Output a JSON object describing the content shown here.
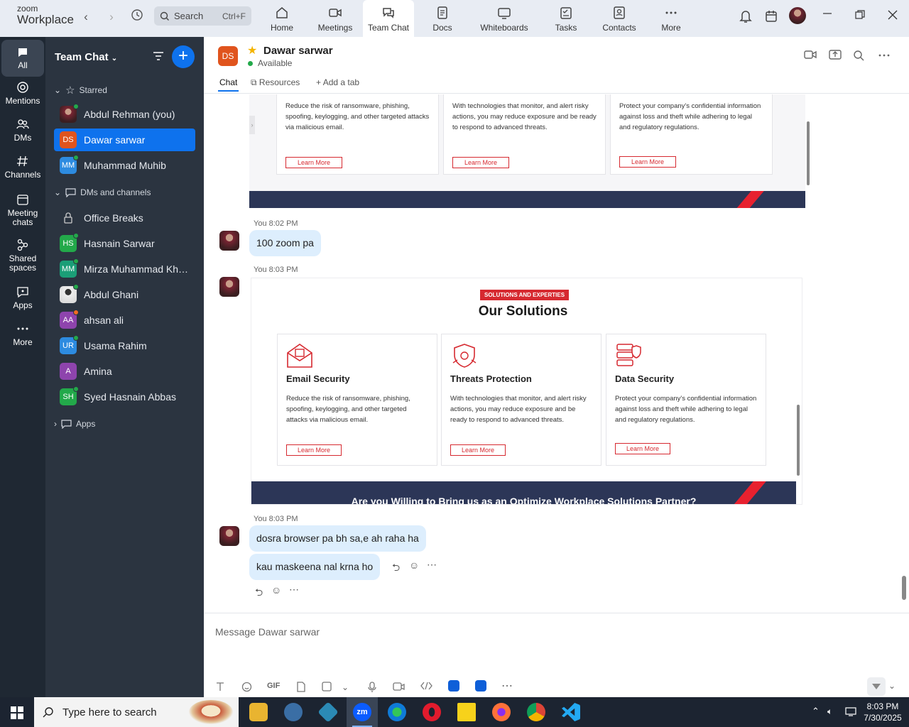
{
  "app": {
    "logo_top": "zoom",
    "logo_bottom": "Workplace"
  },
  "top": {
    "search_label": "Search",
    "search_shortcut": "Ctrl+F",
    "tabs": [
      {
        "label": "Home"
      },
      {
        "label": "Meetings"
      },
      {
        "label": "Team Chat"
      },
      {
        "label": "Docs"
      },
      {
        "label": "Whiteboards"
      },
      {
        "label": "Tasks"
      },
      {
        "label": "Contacts"
      },
      {
        "label": "More"
      }
    ]
  },
  "rail": [
    {
      "label": "All"
    },
    {
      "label": "Mentions"
    },
    {
      "label": "DMs"
    },
    {
      "label": "Channels"
    },
    {
      "label": "Meeting chats"
    },
    {
      "label": "Shared spaces"
    },
    {
      "label": "Apps"
    },
    {
      "label": "More"
    }
  ],
  "sidebar": {
    "title": "Team Chat",
    "starred_label": "Starred",
    "starred": [
      {
        "name": "Abdul Rehman (you)"
      },
      {
        "initials": "DS",
        "name": "Dawar sarwar",
        "color": "#e0541d"
      },
      {
        "initials": "MM",
        "name": "Muhammad Muhib",
        "color": "#2d8be0"
      }
    ],
    "dms_label": "DMs and channels",
    "dms": [
      {
        "name": "Office Breaks"
      },
      {
        "initials": "HS",
        "name": "Hasnain Sarwar",
        "color": "#23a94a"
      },
      {
        "initials": "MM",
        "name": "Mirza Muhammad Khur...",
        "color": "#1b9e77"
      },
      {
        "name": "Abdul Ghani"
      },
      {
        "initials": "AA",
        "name": "ahsan ali",
        "color": "#8e44ad"
      },
      {
        "initials": "UR",
        "name": "Usama Rahim",
        "color": "#2d8be0"
      },
      {
        "initials": "A",
        "name": "Amina",
        "color": "#8e44ad"
      },
      {
        "initials": "SH",
        "name": "Syed Hasnain Abbas",
        "color": "#23a94a"
      }
    ],
    "apps_label": "Apps"
  },
  "chat": {
    "initials": "DS",
    "name": "Dawar sarwar",
    "status": "Available",
    "tabs": {
      "chat": "Chat",
      "resources": "Resources",
      "add": "Add a tab"
    }
  },
  "image1": {
    "cards": [
      {
        "desc": "Reduce the risk of ransomware, phishing, spoofing, keylogging, and other targeted attacks via malicious email.",
        "btn": "Learn More"
      },
      {
        "desc": "With technologies that monitor, and alert risky actions, you may reduce exposure and be ready to respond to advanced threats.",
        "btn": "Learn More"
      },
      {
        "desc": "Protect your company's confidential information against loss and theft while adhering to legal and regulatory regulations.",
        "btn": "Learn More"
      }
    ]
  },
  "messages": {
    "m1_time": "You 8:02 PM",
    "m1_text": "100 zoom pa",
    "m2_time": "You 8:03 PM",
    "m3_time": "You 8:03 PM",
    "m3_text1": "dosra browser pa bh sa,e ah raha ha",
    "m3_text2": "kau maskeena nal krna ho"
  },
  "image2": {
    "badge": "SOLUTIONS AND EXPERTIES",
    "title": "Our Solutions",
    "cards": [
      {
        "title": "Email Security",
        "desc": "Reduce the risk of ransomware, phishing, spoofing, keylogging, and other targeted attacks via malicious email.",
        "btn": "Learn More"
      },
      {
        "title": "Threats Protection",
        "desc": "With technologies that monitor, and alert risky actions, you may reduce exposure and be ready to respond to advanced threats.",
        "btn": "Learn More"
      },
      {
        "title": "Data Security",
        "desc": "Protect your company's confidential information against loss and theft while adhering to legal and regulatory regulations.",
        "btn": "Learn More"
      }
    ],
    "banner": "Are you Willing to Bring us as an Optimize Workplace Solutions Partner?"
  },
  "composer": {
    "placeholder": "Message Dawar sarwar",
    "gif": "GIF"
  },
  "taskbar": {
    "search": "Type here to search",
    "time": "8:03 PM",
    "date": "7/30/2025",
    "zoom": "zm"
  },
  "colors": {
    "accent": "#0e72ed",
    "rail": "#1f2833",
    "sidebar": "#2b3440",
    "bubble": "#ddeefd",
    "brand_red": "#e8212f"
  }
}
